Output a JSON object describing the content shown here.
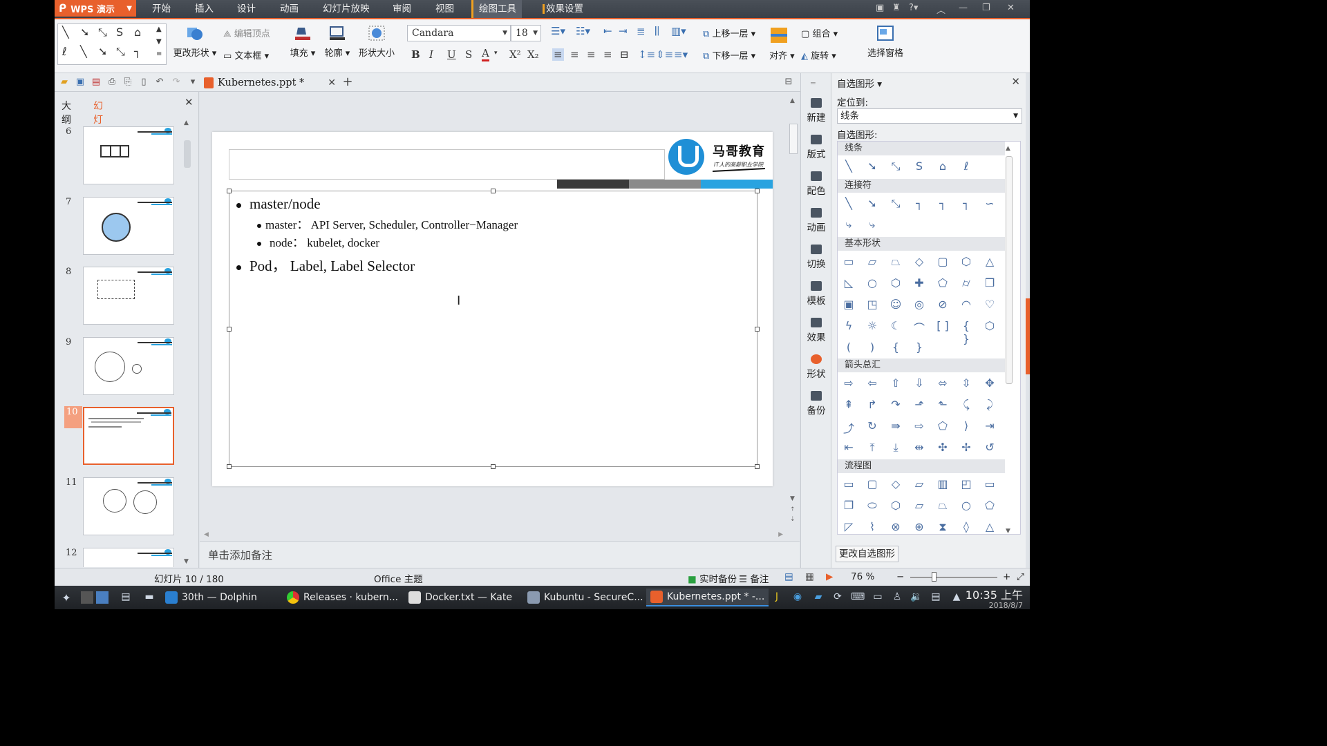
{
  "menubar": {
    "app_name": "WPS 演示",
    "items": [
      "开始",
      "插入",
      "设计",
      "动画",
      "幻灯片放映",
      "审阅",
      "视图",
      "绘图工具",
      "效果设置"
    ],
    "active": "绘图工具",
    "right_icons": [
      "skin-icon",
      "shirt-icon",
      "help-icon",
      "collapse-icon",
      "minimize-icon",
      "restore-icon",
      "close-icon"
    ]
  },
  "ribbon": {
    "edit_vertex": "编辑顶点",
    "change_shape": "更改形状",
    "text_box": "文本框",
    "fill": "填充",
    "outline": "轮廓",
    "shape_size": "形状大小",
    "font_name": "Candara",
    "font_size": "18",
    "bring_forward": "上移一层",
    "send_backward": "下移一层",
    "group": "组合",
    "align": "对齐",
    "rotate": "旋转",
    "selection_pane": "选择窗格"
  },
  "doc_tab": {
    "title": "Kubernetes.ppt *"
  },
  "left_panel": {
    "tabs": [
      "大纲",
      "幻灯片"
    ],
    "active_tab": "幻灯片",
    "slides": [
      6,
      7,
      8,
      9,
      10,
      11,
      12
    ],
    "selected": 10
  },
  "slide": {
    "logo_name": "马哥教育",
    "logo_sub": "IT人的高薪职业学院",
    "bullets": [
      {
        "level": 1,
        "text": "master/node"
      },
      {
        "level": 2,
        "text": "master： API Server, Scheduler, Controller−Manager"
      },
      {
        "level": 2,
        "text": "node： kubelet, docker"
      },
      {
        "level": 1,
        "text": "Pod， Label, Label Selector"
      }
    ],
    "color_bar": [
      "#3a3a3a",
      "#8a8a8a",
      "#29a3e0"
    ]
  },
  "notes": {
    "placeholder": "单击添加备注"
  },
  "side_tools": [
    "新建",
    "版式",
    "配色",
    "动画",
    "切换",
    "模板",
    "效果",
    "形状",
    "备份"
  ],
  "right_panel": {
    "title": "自选图形",
    "locate_label": "定位到:",
    "locate_value": "线条",
    "shapes_label": "自选图形:",
    "categories": [
      "线条",
      "连接符",
      "基本形状",
      "箭头总汇",
      "流程图"
    ],
    "change_button": "更改自选图形"
  },
  "statusbar": {
    "slide_info": "幻灯片 10 / 180",
    "theme": "Office 主题",
    "backup": "实时备份",
    "notes": "备注",
    "zoom": "76 %"
  },
  "taskbar": {
    "tasks": [
      "30th — Dolphin",
      "Releases · kubern...",
      "Docker.txt — Kate",
      "Kubuntu - SecureC...",
      "Kubernetes.ppt * -..."
    ],
    "time": "10:35 上午",
    "date": "2018/8/7"
  },
  "colors": {
    "accent": "#e8602c",
    "blue": "#29a3e0"
  }
}
